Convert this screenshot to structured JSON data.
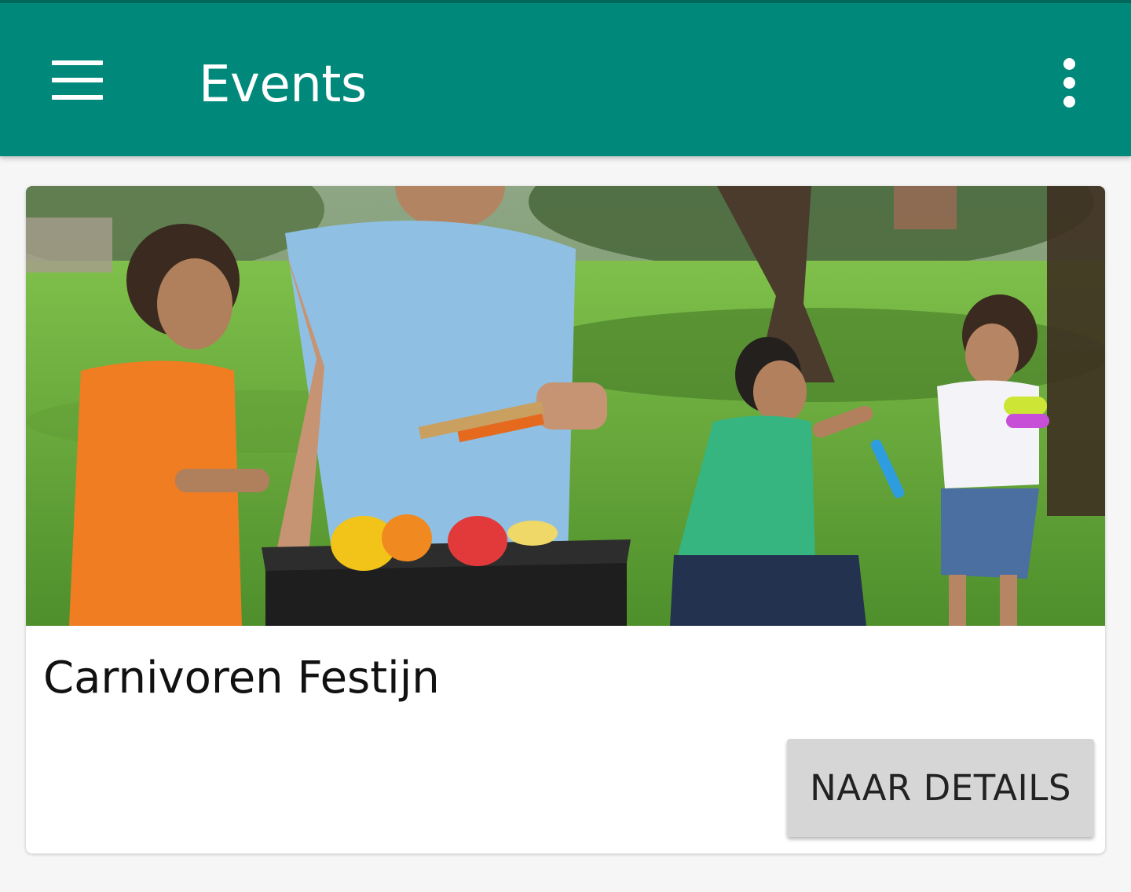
{
  "app_bar": {
    "title": "Events",
    "menu_icon": "hamburger-menu-icon",
    "overflow_icon": "more-vert-icon",
    "color": "#00897b"
  },
  "events": [
    {
      "title": "Carnivoren Festijn",
      "image": "family-barbecue-park-photo",
      "button_label": "NAAR DETAILS"
    }
  ]
}
